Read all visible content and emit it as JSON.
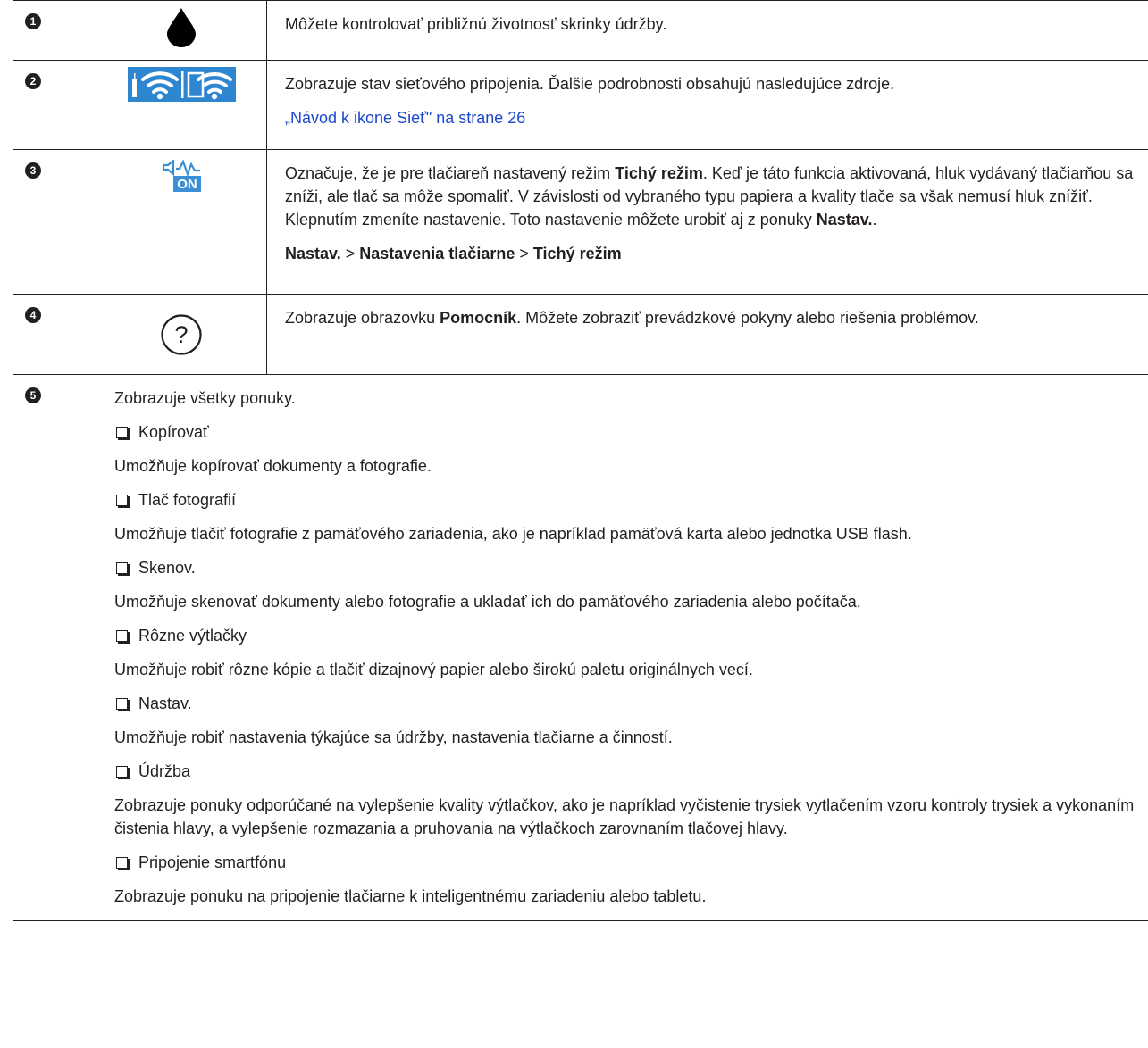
{
  "rows": [
    {
      "num": "1",
      "icon": "ink-drop-icon",
      "text": "Môžete kontrolovať približnú životnosť skrinky údržby."
    },
    {
      "num": "2",
      "icon": "network-status-icon",
      "text": "Zobrazuje stav sieťového pripojenia. Ďalšie podrobnosti obsahujú nasledujúce zdroje.",
      "link": "„Návod k ikone Sieť\" na strane 26"
    },
    {
      "num": "3",
      "icon": "quiet-mode-on-icon",
      "icon_text": "ON",
      "text_a": "Označuje, že je pre tlačiareň nastavený režim ",
      "bold_a": "Tichý režim",
      "text_b": ". Keď je táto funkcia aktivovaná, hluk vydávaný tlačiarňou sa zníži, ale tlač sa môže spomaliť. V závislosti od vybraného typu papiera a kvality tlače sa však nemusí hluk znížiť. Klepnutím zmeníte nastavenie. Toto nastavenie môžete urobiť aj z ponuky ",
      "bold_b": "Nastav.",
      "text_c": ".",
      "path": [
        "Nastav.",
        "Nastavenia tlačiarne",
        "Tichý režim"
      ],
      "path_sep": ">"
    },
    {
      "num": "4",
      "icon": "help-question-icon",
      "icon_text": "?",
      "text_a": "Zobrazuje obrazovku ",
      "bold_a": "Pomocník",
      "text_b": ". Môžete zobraziť prevádzkové pokyny alebo riešenia problémov."
    },
    {
      "num": "5",
      "intro": "Zobrazuje všetky ponuky.",
      "items": [
        {
          "title": "Kopírovať",
          "desc": "Umožňuje kopírovať dokumenty a fotografie."
        },
        {
          "title": "Tlač fotografií",
          "desc": "Umožňuje tlačiť fotografie z pamäťového zariadenia, ako je napríklad pamäťová karta alebo jednotka USB flash."
        },
        {
          "title": "Skenov.",
          "desc": "Umožňuje skenovať dokumenty alebo fotografie a ukladať ich do pamäťového zariadenia alebo počítača."
        },
        {
          "title": "Rôzne výtlačky",
          "desc": "Umožňuje robiť rôzne kópie a tlačiť dizajnový papier alebo širokú paletu originálnych vecí."
        },
        {
          "title": "Nastav.",
          "desc": "Umožňuje robiť nastavenia týkajúce sa údržby, nastavenia tlačiarne a činností."
        },
        {
          "title": "Údržba",
          "desc": "Zobrazuje ponuky odporúčané na vylepšenie kvality výtlačkov, ako je napríklad vyčistenie trysiek vytlačením vzoru kontroly trysiek a vykonaním čistenia hlavy, a vylepšenie rozmazania a pruhovania na výtlačkoch zarovnaním tlačovej hlavy."
        },
        {
          "title": "Pripojenie smartfónu",
          "desc": "Zobrazuje ponuku na pripojenie tlačiarne k inteligentnému zariadeniu alebo tabletu."
        }
      ]
    }
  ],
  "colors": {
    "text": "#231f20",
    "link": "#1b47cc",
    "icon_blue": "#2e86d1",
    "icon_light_blue": "#3b8fd6"
  }
}
